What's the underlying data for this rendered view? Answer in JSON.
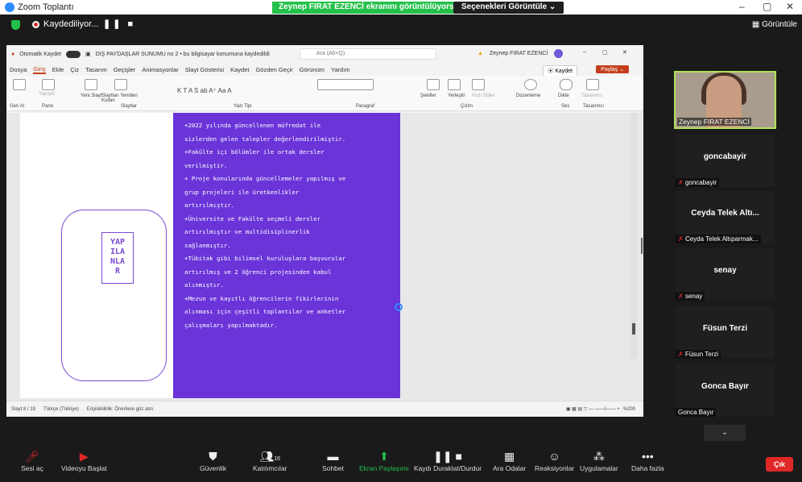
{
  "window": {
    "title": "Zoom Toplantı",
    "share_banner": "Zeynep FIRAT EZENCİ ekranını görüntülüyorsunuz",
    "view_options": "Seçenekleri Görüntüle",
    "controls": [
      "–",
      "▢",
      "✕"
    ]
  },
  "topbar": {
    "recording_label": "Kaydediliyor...",
    "view_label": "Görüntüle"
  },
  "powerpoint": {
    "autosave_label": "Otomatik Kaydet",
    "doc_title": "DIŞ PAYDAŞLAR SUNUMU no 2 • bu bilgisayar konumuna kaydedildi",
    "search_placeholder": "Ara (Alt+Q)",
    "user_name": "Zeynep FIRAT EZENCİ",
    "menu": [
      "Dosya",
      "Giriş",
      "Ekle",
      "Çiz",
      "Tasarım",
      "Geçişler",
      "Animasyonlar",
      "Slayt Gösterisi",
      "Kaydet",
      "Gözden Geçir",
      "Görünüm",
      "Yardım"
    ],
    "active_menu": "Giriş",
    "kaydet_button": "Kaydet",
    "paylas_button": "Paylaş",
    "ribbon_groups": [
      "Geri Al",
      "Pano",
      "Slaytlar",
      "Yazı Tipi",
      "Paragraf",
      "Çizim",
      "Ses",
      "Tasarımcı"
    ],
    "ribbon_labels": {
      "yapistir": "Yapıştır",
      "yeni_slayt": "Yeni Slayt",
      "slaytlari_yeniden": "Slaytları Yeniden Kullan",
      "sekiller": "Şekiller",
      "yerlestir": "Yerleştir",
      "hizli_stiller": "Hızlı Stiller",
      "duzenleme": "Düzenleme",
      "dikte": "Dikte",
      "tasarimci": "Tasarımcı"
    },
    "slide_box_text": "YAP\nILA\nNLA\nR",
    "slide_text": "+2022 yılında güncellenen müfredat ile\nsizlerden gelen talepler değerlendirilmiştir.\n+Fakülte içi bölümler ile ortak dersler\nverilmiştir.\n+ Proje konularında güncellemeler yapılmış ve\ngrup projeleri ile üretkenlikler\nartırılmıştır.\n+Üniversite ve Fakülte seçmeli dersler\nartırılmıştır ve multidisiplinerlik\nsağlanmıştır.\n+Tübitak gibi bilimsel kuruluşlara başvurular\nartırılmış ve 2 öğrenci projesinden kabul\nalınmıştır.\n+Mezun ve kayıtlı öğrencilerin fikirlerinin\nalınması için çeşitli toplantılar ve anketler\nçalışmaları yapılmaktadır.",
    "status": {
      "slide_count": "Slayt 8 / 19",
      "language": "Türkçe (Türkiye)",
      "accessibility": "Erişilebilirlik: Önerilere göz atın",
      "zoom": "%200"
    }
  },
  "participants": {
    "speaker_name": "Zeynep FIRAT EZENCİ",
    "tiles": [
      {
        "name": "goncabayir",
        "label": "goncabayir",
        "muted": true
      },
      {
        "name": "Ceyda Telek Altı...",
        "label": "Ceyda Telek Altıparmak...",
        "muted": true
      },
      {
        "name": "senay",
        "label": "senay",
        "muted": true
      },
      {
        "name": "Füsun Terzi",
        "label": "Füsun Terzi",
        "muted": true
      },
      {
        "name": "Gonca Bayır",
        "label": "Gonca Bayır",
        "muted": false
      }
    ]
  },
  "toolbar": {
    "items": [
      {
        "label": "Sesi aç",
        "icon": "mic-off-icon"
      },
      {
        "label": "Videoyu Başlat",
        "icon": "video-off-icon"
      },
      {
        "label": "Güvenlik",
        "icon": "shield-icon"
      },
      {
        "label": "Katılımcılar",
        "icon": "participants-icon",
        "count": "16"
      },
      {
        "label": "Sohbet",
        "icon": "chat-icon"
      },
      {
        "label": "Ekran Paylaşımı",
        "icon": "share-screen-icon"
      },
      {
        "label": "Kaydı Duraklat/Durdur",
        "icon": "pause-record-icon"
      },
      {
        "label": "Ara Odalar",
        "icon": "breakout-icon"
      },
      {
        "label": "Reaksiyonlar",
        "icon": "reaction-icon"
      },
      {
        "label": "Uygulamalar",
        "icon": "apps-icon"
      },
      {
        "label": "Daha fazla",
        "icon": "more-icon"
      }
    ],
    "leave_label": "Çık"
  },
  "colors": {
    "accent_green": "#24c14a",
    "slide_purple": "#6a34d8",
    "leave_red": "#e02828",
    "ppt_orange": "#c43e1c"
  }
}
